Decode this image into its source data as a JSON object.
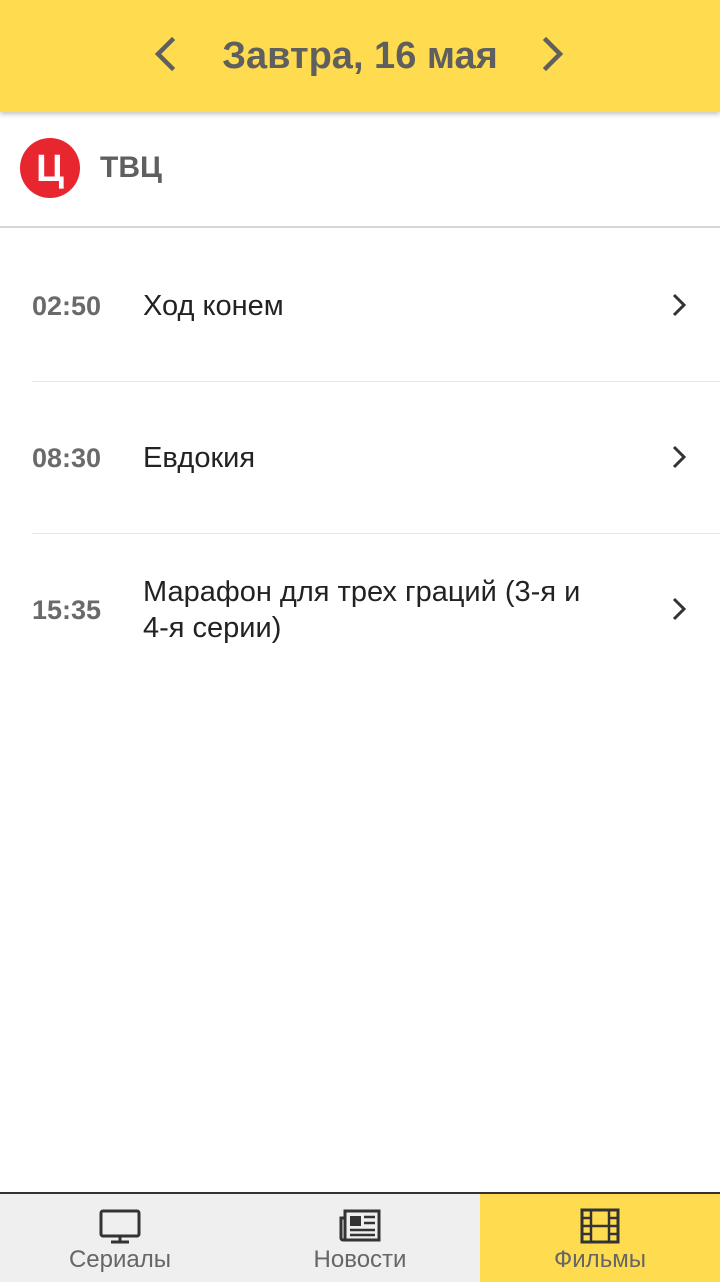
{
  "header": {
    "date_label": "Завтра, 16 мая",
    "prev_icon": "chevron-left-icon",
    "next_icon": "chevron-right-icon",
    "background_color": "#FFDC4F"
  },
  "channel": {
    "logo_text": "Ц",
    "logo_color": "#E8262F",
    "name": "ТВЦ"
  },
  "schedule": [
    {
      "time": "02:50",
      "title": "Ход конем"
    },
    {
      "time": "08:30",
      "title": "Евдокия"
    },
    {
      "time": "15:35",
      "title": "Марафон для трех граций (3-я и 4-я серии)"
    }
  ],
  "tabs": [
    {
      "label": "Сериалы",
      "icon": "tv-icon",
      "active": false
    },
    {
      "label": "Новости",
      "icon": "newspaper-icon",
      "active": false
    },
    {
      "label": "Фильмы",
      "icon": "film-icon",
      "active": true
    }
  ]
}
